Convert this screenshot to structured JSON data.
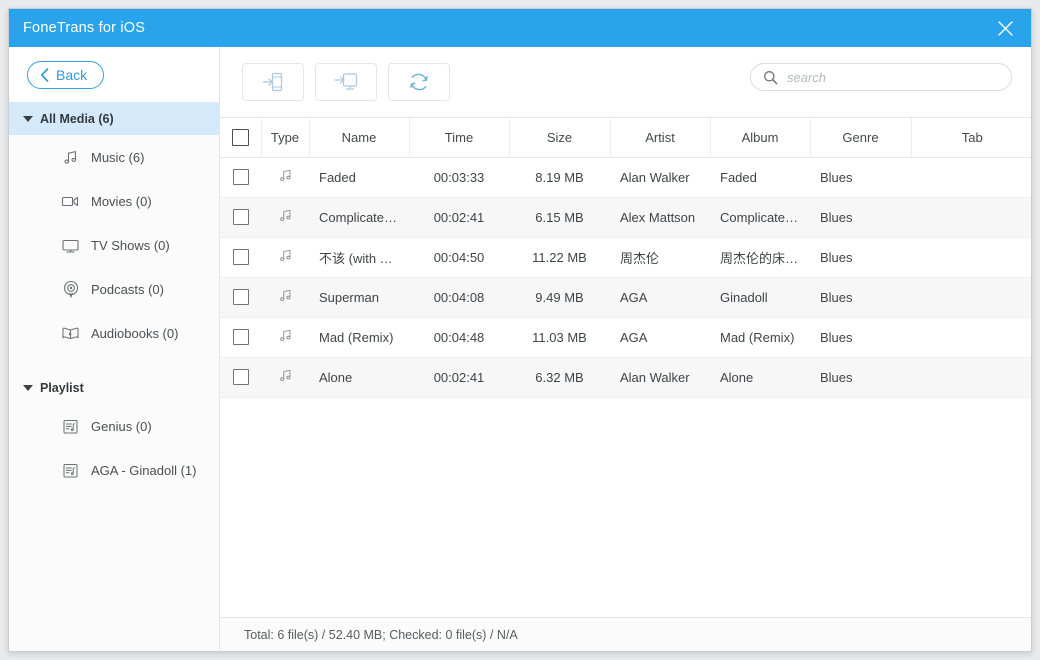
{
  "window": {
    "title": "FoneTrans for iOS",
    "close_icon": "close-icon",
    "accent_color": "#29a3ec"
  },
  "sidebar": {
    "back_label": "Back",
    "back_icon": "chevron-left-icon",
    "groups": [
      {
        "label": "All Media (6)",
        "active": true,
        "caret_icon": "caret-down-icon",
        "items": [
          {
            "label": "Music (6)",
            "icon": "music-note-icon"
          },
          {
            "label": "Movies (0)",
            "icon": "video-camera-icon"
          },
          {
            "label": "TV Shows (0)",
            "icon": "tv-icon"
          },
          {
            "label": "Podcasts (0)",
            "icon": "podcast-icon"
          },
          {
            "label": "Audiobooks (0)",
            "icon": "audiobook-icon"
          }
        ]
      },
      {
        "label": "Playlist",
        "active": false,
        "caret_icon": "caret-down-icon",
        "items": [
          {
            "label": "Genius (0)",
            "icon": "playlist-icon"
          },
          {
            "label": "AGA - Ginadoll (1)",
            "icon": "playlist-icon"
          }
        ]
      }
    ]
  },
  "toolbar": {
    "buttons": [
      {
        "name": "export-to-device-button",
        "icon": "export-to-phone-icon"
      },
      {
        "name": "export-to-pc-button",
        "icon": "export-to-pc-icon"
      },
      {
        "name": "refresh-button",
        "icon": "refresh-icon"
      }
    ],
    "search": {
      "placeholder": "search",
      "value": "",
      "icon": "search-icon"
    }
  },
  "table": {
    "columns": [
      "Type",
      "Name",
      "Time",
      "Size",
      "Artist",
      "Album",
      "Genre",
      "Tab"
    ],
    "select_all_checked": false,
    "rows": [
      {
        "checked": false,
        "type_icon": "music-note-icon",
        "name": "Faded",
        "time": "00:03:33",
        "size": "8.19 MB",
        "artist": "Alan Walker",
        "album": "Faded",
        "genre": "Blues",
        "tab": ""
      },
      {
        "checked": false,
        "type_icon": "music-note-icon",
        "name": "Complicated L...",
        "time": "00:02:41",
        "size": "6.15 MB",
        "artist": "Alex Mattson",
        "album": "Complicated L...",
        "genre": "Blues",
        "tab": ""
      },
      {
        "checked": false,
        "type_icon": "music-note-icon",
        "name": "不该 (with aMEI)",
        "time": "00:04:50",
        "size": "11.22 MB",
        "artist": "周杰伦",
        "album": "周杰伦的床边...",
        "genre": "Blues",
        "tab": ""
      },
      {
        "checked": false,
        "type_icon": "music-note-icon",
        "name": "Superman",
        "time": "00:04:08",
        "size": "9.49 MB",
        "artist": "AGA",
        "album": "Ginadoll",
        "genre": "Blues",
        "tab": ""
      },
      {
        "checked": false,
        "type_icon": "music-note-icon",
        "name": "Mad (Remix)",
        "time": "00:04:48",
        "size": "11.03 MB",
        "artist": "AGA",
        "album": "Mad (Remix)",
        "genre": "Blues",
        "tab": ""
      },
      {
        "checked": false,
        "type_icon": "music-note-icon",
        "name": "Alone",
        "time": "00:02:41",
        "size": "6.32 MB",
        "artist": "Alan Walker",
        "album": "Alone",
        "genre": "Blues",
        "tab": ""
      }
    ]
  },
  "statusbar": {
    "text": "Total: 6 file(s) / 52.40 MB; Checked: 0 file(s) / N/A"
  }
}
